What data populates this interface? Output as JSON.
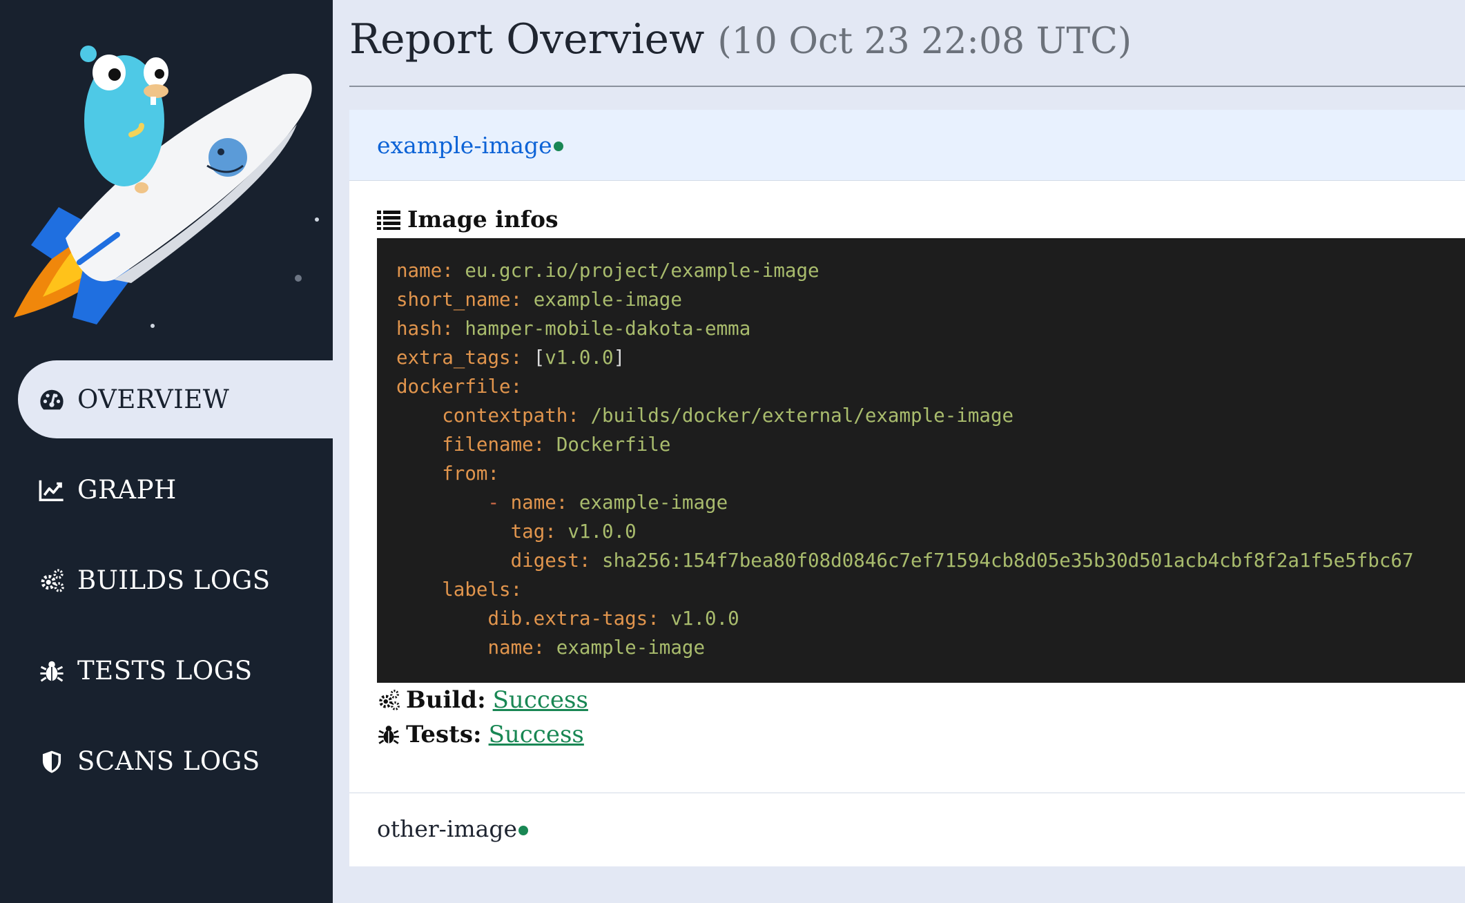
{
  "sidebar": {
    "items": [
      {
        "label": "OVERVIEW",
        "icon": "dashboard-gauge-icon",
        "active": true
      },
      {
        "label": "GRAPH",
        "icon": "line-chart-icon"
      },
      {
        "label": "BUILDS LOGS",
        "icon": "gears-icon"
      },
      {
        "label": "TESTS LOGS",
        "icon": "bug-icon"
      },
      {
        "label": "SCANS LOGS",
        "icon": "shield-icon"
      }
    ]
  },
  "header": {
    "title": "Report Overview",
    "timestamp": "(10 Oct 23 22:08 UTC)"
  },
  "images": [
    {
      "name": "example-image",
      "expanded": true,
      "status_color": "#198754",
      "infos_title": "Image infos",
      "yaml": {
        "name": "eu.gcr.io/project/example-image",
        "short_name": "example-image",
        "hash": "hamper-mobile-dakota-emma",
        "extra_tags": "v1.0.0",
        "dockerfile": {
          "contextpath": "/builds/docker/external/example-image",
          "filename": "Dockerfile",
          "from": {
            "name": "example-image",
            "tag": "v1.0.0",
            "digest": "sha256:154f7bea80f08d0846c7ef71594cb8d05e35b30d501acb4cbf8f2a1f5e5fbc67"
          }
        },
        "labels": {
          "dib_extra_tags": "v1.0.0",
          "name": "example-image"
        }
      },
      "build_label": "Build:",
      "build_status": "Success",
      "tests_label": "Tests:",
      "tests_status": "Success"
    },
    {
      "name": "other-image",
      "expanded": false,
      "status_color": "#198754"
    }
  ],
  "colors": {
    "sidebar_bg": "#18212e",
    "page_bg": "#e3e8f4",
    "accent_blue": "#0d63d6",
    "success_green": "#198754"
  }
}
